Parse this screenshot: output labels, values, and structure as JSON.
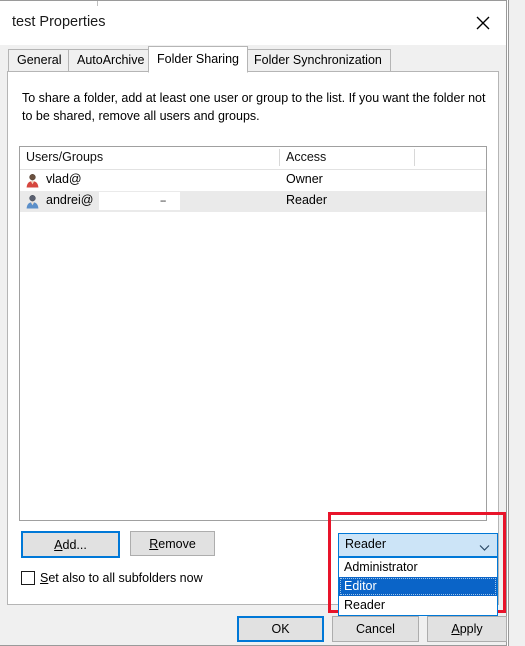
{
  "window": {
    "title": "test Properties",
    "close_icon": "close-icon"
  },
  "tabs": [
    {
      "label": "General",
      "active": false
    },
    {
      "label": "AutoArchive",
      "active": false
    },
    {
      "label": "Folder Sharing",
      "active": true
    },
    {
      "label": "Folder Synchronization",
      "active": false
    }
  ],
  "panel": {
    "description": "To share a folder, add at least one user or group to the list. If you want the folder not to be shared, remove all users and groups."
  },
  "list": {
    "columns": [
      "Users/Groups",
      "Access"
    ],
    "rows": [
      {
        "user": "vlad@",
        "access": "Owner",
        "selected": false,
        "redacted": false,
        "icon": "user-icon"
      },
      {
        "user": "andrei@",
        "access": "Reader",
        "selected": true,
        "redacted": true,
        "redaction_mark": "--",
        "icon": "user-icon"
      }
    ]
  },
  "actions": {
    "add_label": "Add...",
    "add_accel": "A",
    "remove_label": "Remove",
    "remove_accel": "R",
    "checkbox_label": "Set also to all subfolders now",
    "checkbox_accel": "S",
    "checkbox_checked": false
  },
  "access_combo": {
    "value": "Reader",
    "expanded": true,
    "arrow_icon": "chevron-down-icon",
    "options": [
      {
        "label": "Administrator",
        "highlighted": false
      },
      {
        "label": "Editor",
        "highlighted": true
      },
      {
        "label": "Reader",
        "highlighted": false
      }
    ]
  },
  "dialog_buttons": {
    "ok": "OK",
    "cancel": "Cancel",
    "apply": "Apply",
    "apply_accel": "A"
  },
  "colors": {
    "accent": "#0078d7",
    "highlight": "#0a64c8",
    "annotation": "#e8142a",
    "combo_fill": "#cce4f7",
    "row_selected": "#eaeaea"
  }
}
